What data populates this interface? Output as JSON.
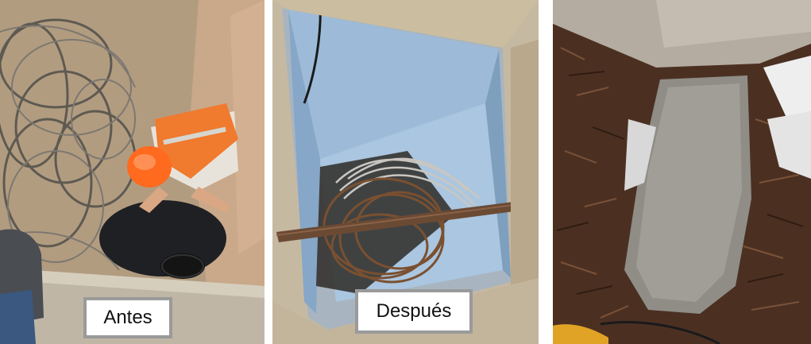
{
  "panels": [
    {
      "caption": "Antes"
    },
    {
      "caption": "Después"
    },
    {
      "caption": ""
    }
  ]
}
